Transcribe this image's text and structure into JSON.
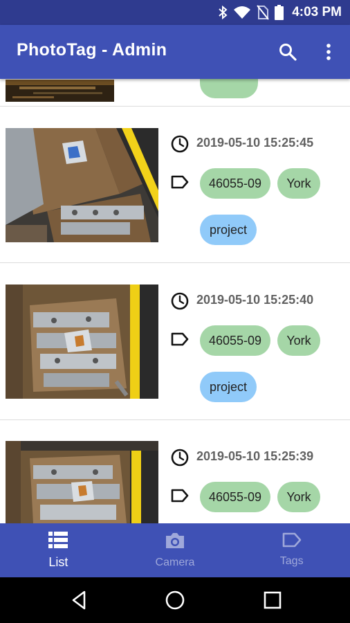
{
  "status_bar": {
    "time": "4:03 PM",
    "icons": [
      "bluetooth-icon",
      "wifi-icon",
      "no-sim-icon",
      "battery-icon"
    ]
  },
  "app_bar": {
    "title": "PhotoTag - Admin",
    "actions": [
      "search-icon",
      "more-vert-icon"
    ]
  },
  "list": {
    "items": [
      {
        "timestamp": "2019-05-10 15:25:45",
        "tags": [
          {
            "label": "46055-09",
            "color": "#a5d6a7"
          },
          {
            "label": "York",
            "color": "#a5d6a7"
          },
          {
            "label": "project",
            "color": "#90caf9"
          }
        ]
      },
      {
        "timestamp": "2019-05-10 15:25:40",
        "tags": [
          {
            "label": "46055-09",
            "color": "#a5d6a7"
          },
          {
            "label": "York",
            "color": "#a5d6a7"
          },
          {
            "label": "project",
            "color": "#90caf9"
          }
        ]
      },
      {
        "timestamp": "2019-05-10 15:25:39",
        "tags": [
          {
            "label": "46055-09",
            "color": "#a5d6a7"
          },
          {
            "label": "York",
            "color": "#a5d6a7"
          }
        ]
      }
    ]
  },
  "bottom_nav": {
    "items": [
      {
        "label": "List",
        "icon": "list-icon",
        "active": true
      },
      {
        "label": "Camera",
        "icon": "camera-icon",
        "active": false
      },
      {
        "label": "Tags",
        "icon": "label-icon",
        "active": false
      }
    ]
  },
  "system_nav": [
    "back-icon",
    "home-icon",
    "recents-icon"
  ],
  "colors": {
    "primary": "#3f51b5",
    "primary_dark": "#2f3b8f",
    "chip_green": "#a5d6a7",
    "chip_blue": "#90caf9",
    "nav_inactive": "#9fa8da"
  }
}
